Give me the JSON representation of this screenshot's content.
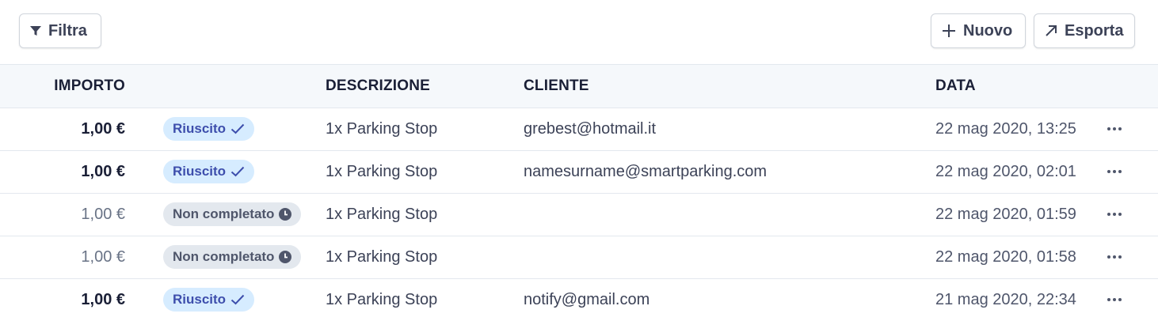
{
  "toolbar": {
    "filter_label": "Filtra",
    "new_label": "Nuovo",
    "export_label": "Esporta"
  },
  "table": {
    "headers": {
      "amount": "IMPORTO",
      "description": "DESCRIZIONE",
      "customer": "CLIENTE",
      "date": "DATA"
    },
    "rows": [
      {
        "amount": "1,00 €",
        "status": "Riuscito",
        "status_type": "success",
        "description": "1x Parking Stop",
        "customer": "grebest@hotmail.it",
        "date": "22 mag 2020, 13:25"
      },
      {
        "amount": "1,00 €",
        "status": "Riuscito",
        "status_type": "success",
        "description": "1x Parking Stop",
        "customer": "namesurname@smartparking.com",
        "date": "22 mag 2020, 02:01"
      },
      {
        "amount": "1,00 €",
        "status": "Non completato",
        "status_type": "pending",
        "description": "1x Parking Stop",
        "customer": "",
        "date": "22 mag 2020, 01:59"
      },
      {
        "amount": "1,00 €",
        "status": "Non completato",
        "status_type": "pending",
        "description": "1x Parking Stop",
        "customer": "",
        "date": "22 mag 2020, 01:58"
      },
      {
        "amount": "1,00 €",
        "status": "Riuscito",
        "status_type": "success",
        "description": "1x Parking Stop",
        "customer": "notify@gmail.com",
        "date": "21 mag 2020, 22:34"
      }
    ]
  },
  "icons": {
    "filter": "filter-icon",
    "plus": "plus-icon",
    "export": "arrow-up-right-icon",
    "check": "check-icon",
    "clock": "clock-icon",
    "more": "more-horizontal-icon"
  },
  "colors": {
    "success_bg": "#d6ecff",
    "success_text": "#3d4eac",
    "pending_bg": "#e3e8ee",
    "pending_text": "#4f566b",
    "header_bg": "#f5f8fb"
  }
}
